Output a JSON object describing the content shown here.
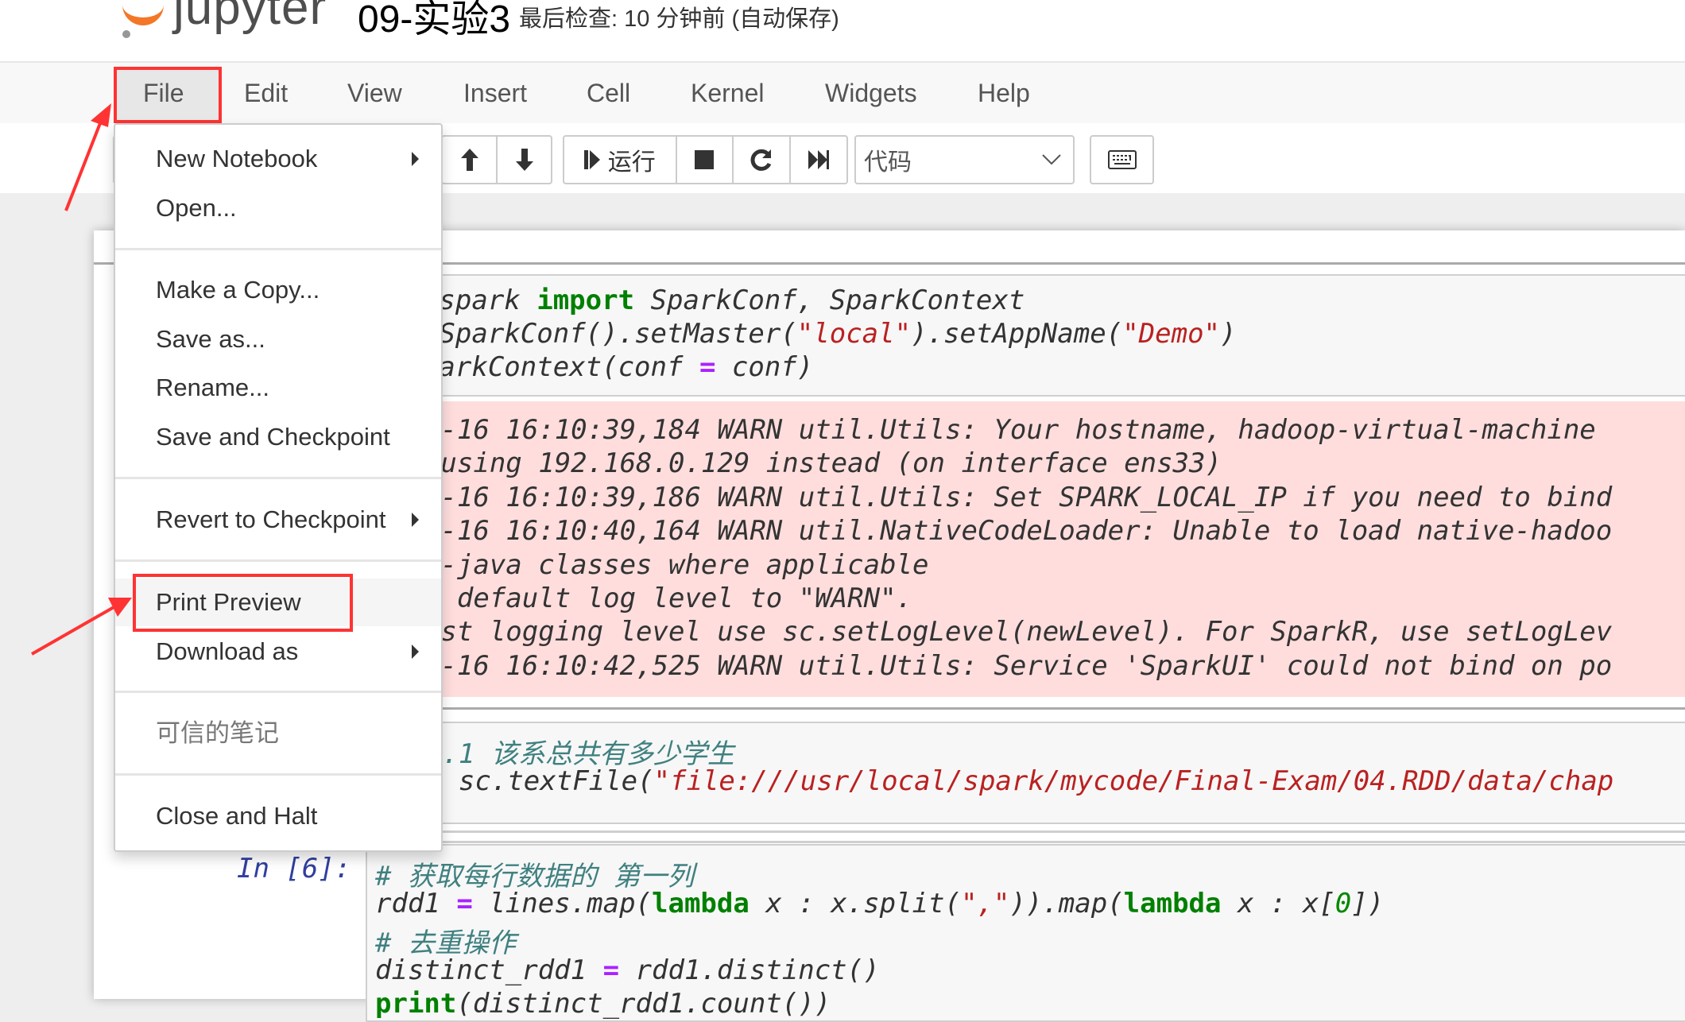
{
  "header": {
    "logo_text": "jupyter",
    "notebook_title": "09-实验3",
    "checkpoint_status": "最后检查: 10 分钟前  (自动保存)"
  },
  "menubar": {
    "items": [
      "File",
      "Edit",
      "View",
      "Insert",
      "Cell",
      "Kernel",
      "Widgets",
      "Help"
    ],
    "active": "File"
  },
  "toolbar": {
    "run_label": "运行",
    "cell_type_selected": "代码",
    "icons": [
      "move-up-icon",
      "move-down-icon",
      "run-icon",
      "stop-icon",
      "restart-icon",
      "fast-forward-icon",
      "keyboard-icon"
    ]
  },
  "file_menu": {
    "items": [
      {
        "label": "New Notebook",
        "submenu": true
      },
      {
        "label": "Open..."
      },
      {
        "label": "Make a Copy..."
      },
      {
        "label": "Save as..."
      },
      {
        "label": "Rename..."
      },
      {
        "label": "Save and Checkpoint"
      },
      {
        "label": "Revert to Checkpoint",
        "submenu": true
      },
      {
        "label": "Print Preview",
        "highlighted": true
      },
      {
        "label": "Download as",
        "submenu": true
      },
      {
        "label": "可信的笔记",
        "disabled": true
      },
      {
        "label": "Close and Halt"
      }
    ]
  },
  "annotation": {
    "highlight_color": "#ff3333"
  },
  "cells": {
    "cell1": {
      "lines": [
        " pyspark import SparkConf, SparkContext",
        " = SparkConf().setMaster(\"local\").setAppName(\"Demo\")",
        " SparkContext(conf = conf)"
      ],
      "output": [
        "-06-16 16:10:39,184 WARN util.Utils: Your hostname, hadoop-virtual-machine",
        "1; using 192.168.0.129 instead (on interface ens33)",
        "-06-16 16:10:39,186 WARN util.Utils: Set SPARK_LOCAL_IP if you need to bind",
        "-06-16 16:10:40,164 WARN util.NativeCodeLoader: Unable to load native-hadoo",
        "tin-java classes where applicable",
        "ing default log level to \"WARN\".",
        "djust logging level use sc.setLogLevel(newLevel). For SparkR, use setLogLev",
        "-06-16 16:10:42,525 WARN util.Utils: Service 'SparkUI' could not bind on po"
      ]
    },
    "cell2": {
      "line1_comment": "se1.1 该系总共有多少学生",
      "line2_prefix": "s ",
      "line2_eq": "=",
      "line2_call": " sc.textFile(",
      "line2_str": "\"file:///usr/local/spark/mycode/Final-Exam/04.RDD/data/chap"
    },
    "cell3": {
      "prompt": "In [6]:",
      "comment1": "# 获取每行数据的 第一列",
      "comment2": "# 去重操作",
      "line4": "distinct_rdd1 = rdd1.distinct()",
      "line5": "print(distinct_rdd1.count())"
    }
  }
}
